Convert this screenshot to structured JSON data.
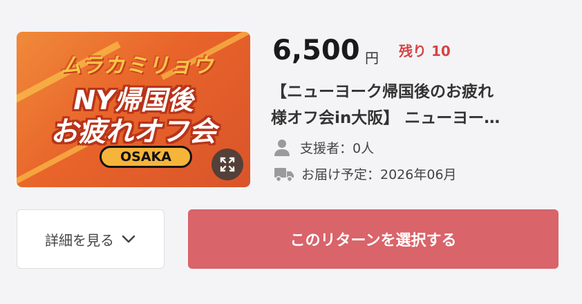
{
  "reward": {
    "image_text": {
      "line1": "ムラカミリョウ",
      "line2": "NY帰国後",
      "line3": "お疲れオフ会",
      "badge": "OSAKA"
    },
    "price": "6,500",
    "currency": "円",
    "remaining": "残り 10",
    "title_line1": "【ニューヨーク帰国後のお疲れ",
    "title_line2": "様オフ会in大阪】 ニューヨー…",
    "supporters": "支援者：0人",
    "delivery": "お届け予定：2026年06月",
    "detail_button": "詳細を見る",
    "select_button": "このリターンを選択する"
  },
  "colors": {
    "accent": "#d9646a",
    "remaining": "#d54545"
  },
  "icons": [
    "person-icon",
    "truck-icon",
    "expand-icon",
    "chevron-down-icon"
  ]
}
